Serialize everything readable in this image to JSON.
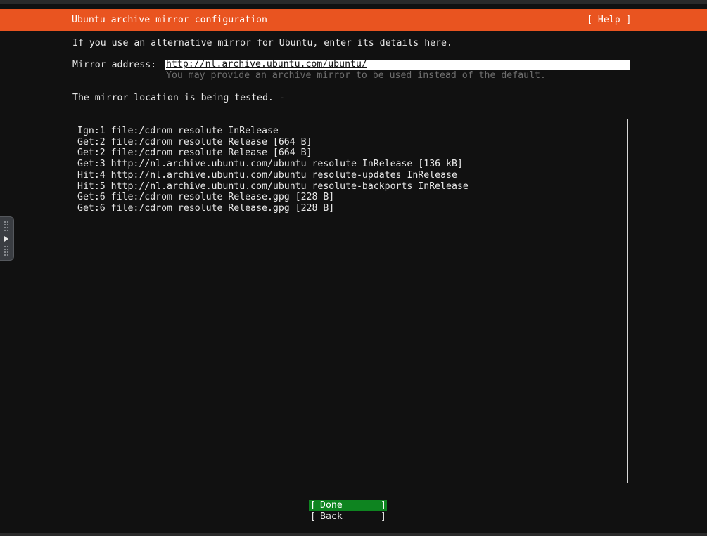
{
  "header": {
    "title": "Ubuntu archive mirror configuration",
    "help_label": "[ Help ]"
  },
  "intro_text": "If you use an alternative mirror for Ubuntu, enter its details here.",
  "mirror": {
    "label": "Mirror address:",
    "value": "http://nl.archive.ubuntu.com/ubuntu/",
    "hint": "You may provide an archive mirror to be used instead of the default."
  },
  "status_text": "The mirror location is being tested. -",
  "log_lines": [
    "Ign:1 file:/cdrom resolute InRelease",
    "Get:2 file:/cdrom resolute Release [664 B]",
    "Get:2 file:/cdrom resolute Release [664 B]",
    "Get:3 http://nl.archive.ubuntu.com/ubuntu resolute InRelease [136 kB]",
    "Hit:4 http://nl.archive.ubuntu.com/ubuntu resolute-updates InRelease",
    "Hit:5 http://nl.archive.ubuntu.com/ubuntu resolute-backports InRelease",
    "Get:6 file:/cdrom resolute Release.gpg [228 B]",
    "Get:6 file:/cdrom resolute Release.gpg [228 B]"
  ],
  "buttons": {
    "done": {
      "bracket_open": "[",
      "hotkey": "D",
      "rest": "one",
      "bracket_close": "]"
    },
    "back": {
      "bracket_open": "[",
      "label": "Back",
      "bracket_close": "]"
    }
  },
  "colors": {
    "header_bg": "#e95420",
    "done_bg": "#0e8420",
    "background": "#111111"
  },
  "side_panel": {
    "icon": "play-arrow-icon"
  }
}
